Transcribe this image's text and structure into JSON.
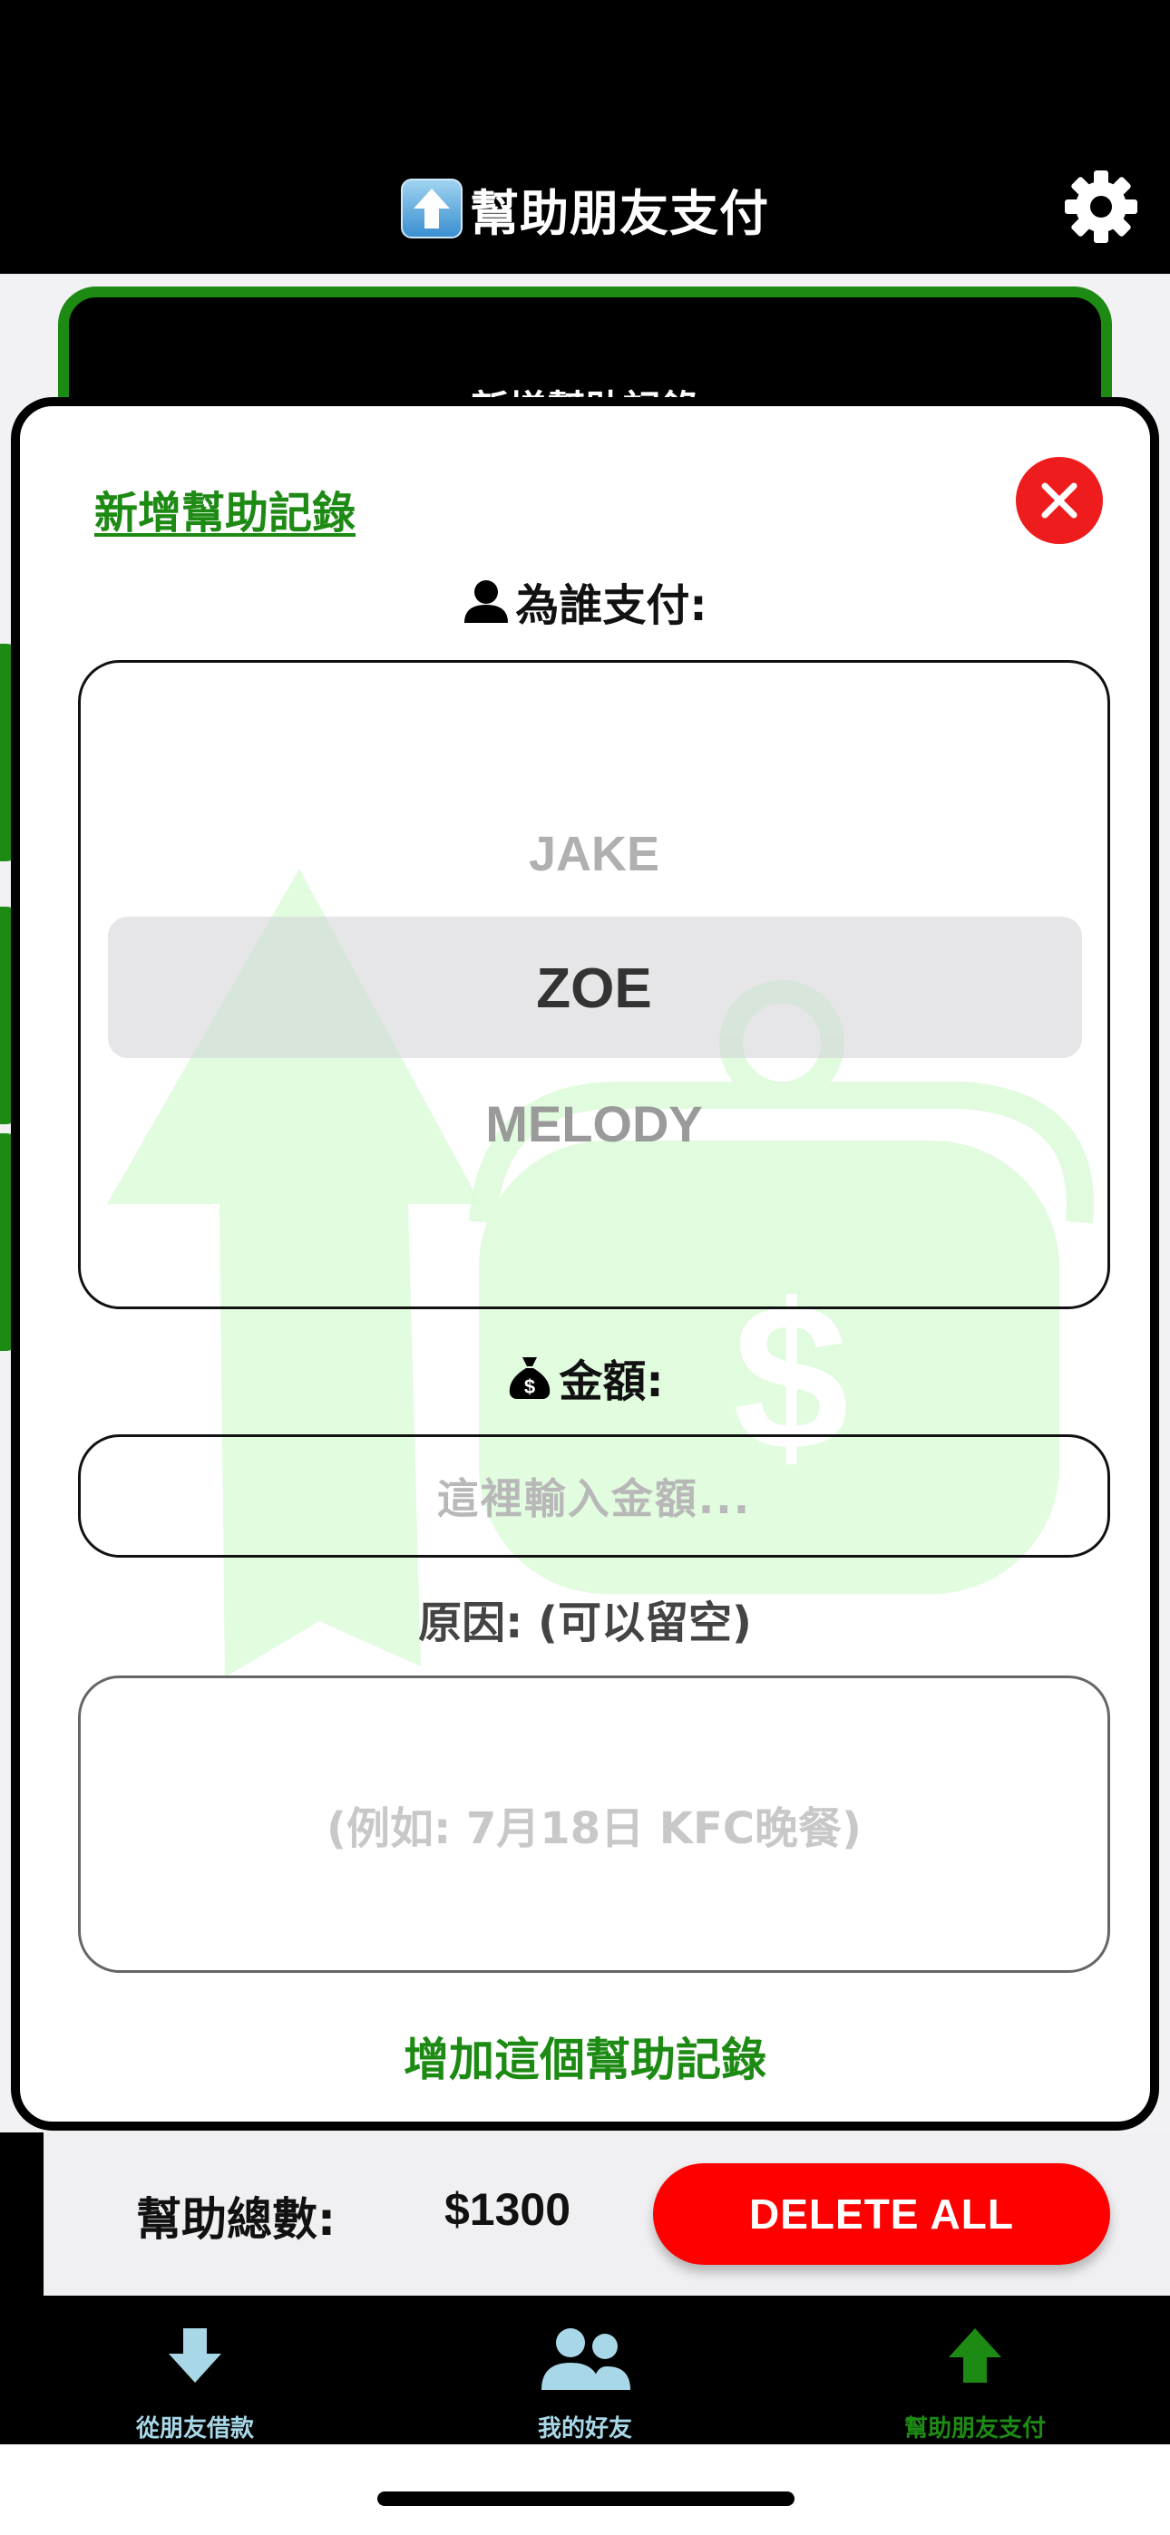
{
  "header": {
    "title": "幫助朋友支付",
    "title_icon": "up-arrow-emoji-icon",
    "settings_icon": "gear-icon"
  },
  "background_card": {
    "label": ">新增幫助記錄<"
  },
  "modal": {
    "title": "新增幫助記錄",
    "close_icon": "close-icon",
    "for_whom_label": "為誰支付:",
    "picker": {
      "items": [
        "JAKE",
        "ZOE",
        "MELODY"
      ],
      "selected": "ZOE"
    },
    "amount_label": "金額:",
    "amount_placeholder": "這裡輸入金額...",
    "reason_label": "原因: (可以留空)",
    "reason_placeholder": "(例如: 7月18日 KFC晚餐)",
    "add_button": "增加這個幫助記錄"
  },
  "summary": {
    "total_label": "幫助總數:",
    "total_value": "$1300",
    "delete_all": "DELETE ALL"
  },
  "tabbar": {
    "tabs": [
      {
        "label": "從朋友借款",
        "icon": "down-arrow-icon",
        "color": "#a8d8e8",
        "active": false
      },
      {
        "label": "我的好友",
        "icon": "friends-icon",
        "color": "#a8d8e8",
        "active": false
      },
      {
        "label": "幫助朋友支付",
        "icon": "up-arrow-icon",
        "color": "#1d8a14",
        "active": true
      }
    ]
  },
  "colors": {
    "accent_green": "#1d8a14",
    "danger_red": "#ff0000",
    "close_red": "#ee1c1c",
    "tab_inactive": "#a8d8e8"
  }
}
